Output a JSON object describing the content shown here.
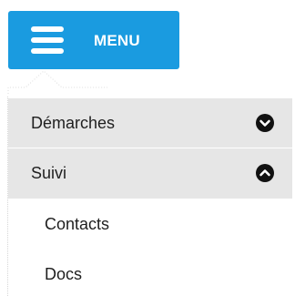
{
  "menu_button": {
    "label": "MENU",
    "icon": "hamburger-icon",
    "color": "#1a9be0"
  },
  "dropdown": {
    "items": [
      {
        "label": "Démarches",
        "icon": "chevron-down-circle-icon",
        "expanded": false
      },
      {
        "label": "Suivi",
        "icon": "chevron-up-circle-icon",
        "expanded": true
      }
    ],
    "subitems": [
      {
        "label": "Contacts"
      },
      {
        "label": "Docs"
      }
    ]
  }
}
